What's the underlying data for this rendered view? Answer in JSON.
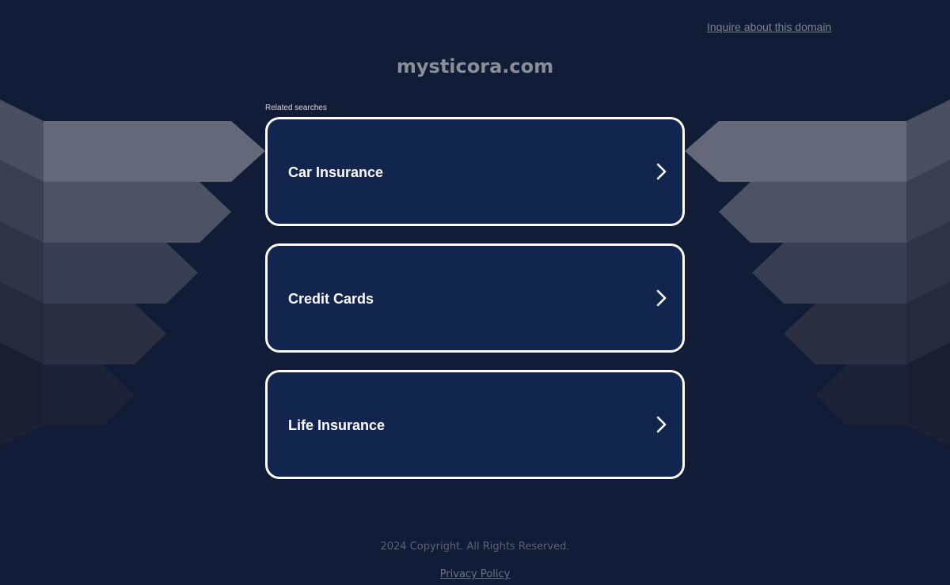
{
  "header": {
    "inquire_link": "Inquire about this domain",
    "domain_title": "mysticora.com"
  },
  "related": {
    "label": "Related searches",
    "items": [
      {
        "label": "Car Insurance",
        "icon": "chevron-right-icon"
      },
      {
        "label": "Credit Cards",
        "icon": "chevron-right-icon"
      },
      {
        "label": "Life Insurance",
        "icon": "chevron-right-icon"
      }
    ]
  },
  "footer": {
    "copyright": "2024 Copyright. All Rights Reserved.",
    "privacy_link": "Privacy Policy"
  },
  "colors": {
    "background": "#111c36",
    "card_background": "#11254f",
    "card_border": "#ffffff",
    "title_text": "#8a8f97"
  }
}
